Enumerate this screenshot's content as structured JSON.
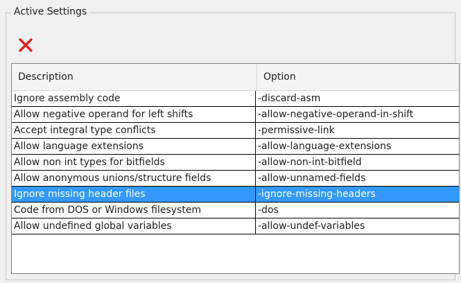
{
  "group": {
    "title": "Active Settings"
  },
  "toolbar": {
    "delete_icon": "red-x-delete-icon",
    "delete_color": "#e2231a"
  },
  "table": {
    "columns": [
      "Description",
      "Option"
    ],
    "selected_row": 6,
    "selection_color": "#3399ff",
    "rows": [
      {
        "description": "Ignore assembly code",
        "option": "-discard-asm"
      },
      {
        "description": "Allow negative operand for left shifts",
        "option": "-allow-negative-operand-in-shift"
      },
      {
        "description": "Accept integral type conflicts",
        "option": "-permissive-link"
      },
      {
        "description": "Allow language extensions",
        "option": "-allow-language-extensions"
      },
      {
        "description": "Allow non int types for bitfields",
        "option": "-allow-non-int-bitfield"
      },
      {
        "description": "Allow anonymous unions/structure fields",
        "option": "-allow-unnamed-fields"
      },
      {
        "description": "Ignore missing header files",
        "option": "-ignore-missing-headers"
      },
      {
        "description": "Code from DOS or Windows filesystem",
        "option": "-dos"
      },
      {
        "description": "Allow undefined global variables",
        "option": "-allow-undef-variables"
      }
    ]
  }
}
